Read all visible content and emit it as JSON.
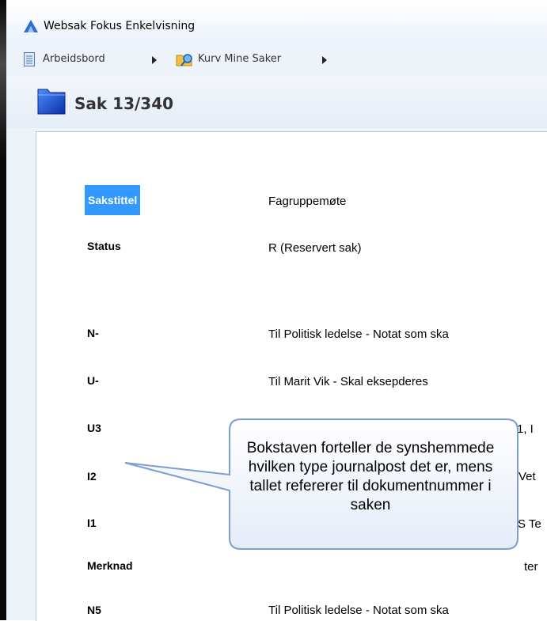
{
  "window": {
    "title": "Websak Fokus Enkelvisning"
  },
  "breadcrumb": {
    "items": [
      {
        "label": "Arbeidsbord",
        "icon": "document-icon"
      },
      {
        "label": "Kurv Mine Saker",
        "icon": "folder-search-icon"
      }
    ]
  },
  "case": {
    "title": "Sak 13/340"
  },
  "fields": [
    {
      "label": "Sakstittel",
      "value": "Fagruppemøte"
    },
    {
      "label": "Status",
      "value": "R (Reservert sak)"
    }
  ],
  "journal_rows": [
    {
      "label": "N-",
      "value": "Til Politisk ledelse - Notat som ska"
    },
    {
      "label": "U-",
      "value": "Til Marit Vik - Skal eksepderes"
    },
    {
      "label": "U3",
      "value": "-1, I"
    },
    {
      "label": "I2",
      "value": "Vet"
    },
    {
      "label": "I1",
      "value": "S Te"
    },
    {
      "label": "Merknad",
      "value": "ter"
    },
    {
      "label": "N5",
      "value": "Til Politisk ledelse - Notat som ska"
    }
  ],
  "callout": {
    "text": "Bokstaven forteller de synshemmede hvilken type journalpost det er, mens tallet refererer til dokumentnummer i saken"
  },
  "colors": {
    "highlight": "#3399ff",
    "callout_border": "#7c9fd0"
  }
}
